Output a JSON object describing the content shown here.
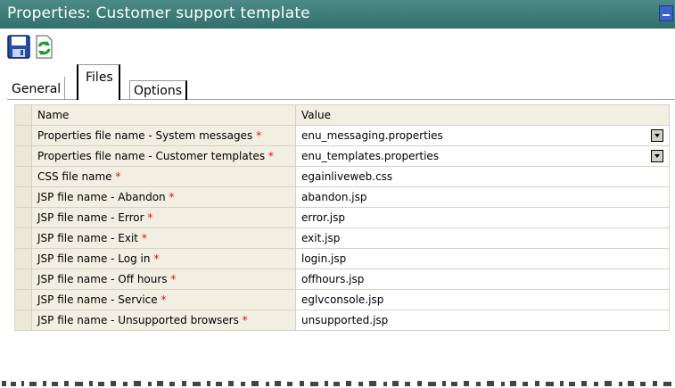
{
  "window": {
    "title": "Properties: Customer support template"
  },
  "toolbar": {
    "buttons": [
      {
        "icon": "save-icon"
      },
      {
        "icon": "refresh-icon"
      }
    ]
  },
  "tabs": [
    {
      "label": "General",
      "active": false
    },
    {
      "label": "Files",
      "active": true
    },
    {
      "label": "Options",
      "active": false
    }
  ],
  "grid": {
    "columns": [
      "Name",
      "Value"
    ],
    "rows": [
      {
        "name": "Properties file name - System messages",
        "required": "*",
        "value": "enu_messaging.properties",
        "dropdown": true
      },
      {
        "name": "Properties file name - Customer templates",
        "required": "*",
        "value": "enu_templates.properties",
        "dropdown": true
      },
      {
        "name": "CSS file name",
        "required": "*",
        "value": "egainliveweb.css",
        "dropdown": false
      },
      {
        "name": "JSP file name - Abandon",
        "required": "*",
        "value": "abandon.jsp",
        "dropdown": false
      },
      {
        "name": "JSP file name - Error",
        "required": "*",
        "value": "error.jsp",
        "dropdown": false
      },
      {
        "name": "JSP file name - Exit",
        "required": "*",
        "value": "exit.jsp",
        "dropdown": false
      },
      {
        "name": "JSP file name - Log in",
        "required": "*",
        "value": "login.jsp",
        "dropdown": false
      },
      {
        "name": "JSP file name - Off hours",
        "required": "*",
        "value": "offhours.jsp",
        "dropdown": false
      },
      {
        "name": "JSP file name - Service",
        "required": "*",
        "value": "eglvconsole.jsp",
        "dropdown": false
      },
      {
        "name": "JSP file name - Unsupported browsers",
        "required": "*",
        "value": "unsupported.jsp",
        "dropdown": false
      }
    ]
  },
  "colors": {
    "titlebar": "#3d7c78",
    "required": "#ff0000",
    "row_header": "#f1efe2"
  }
}
